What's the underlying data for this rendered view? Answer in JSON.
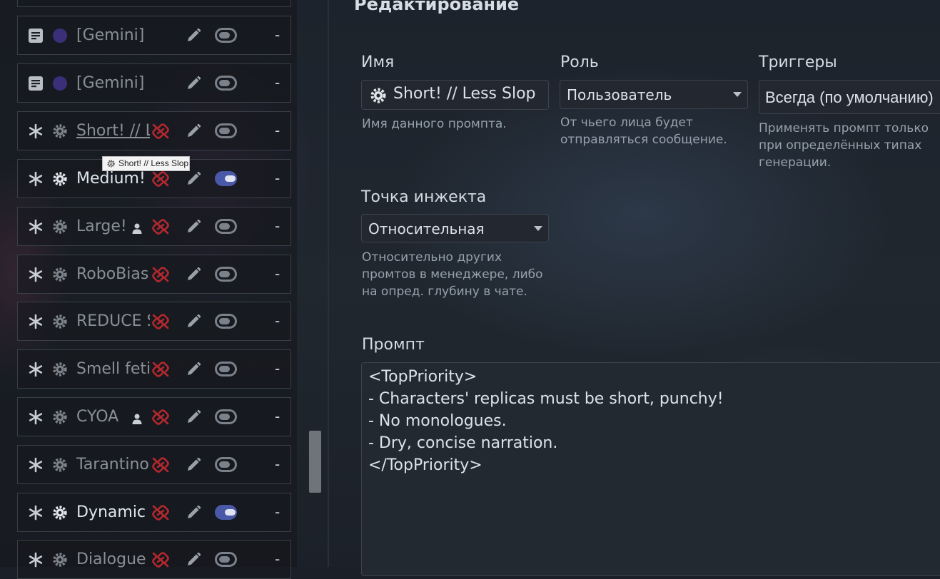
{
  "prompt_list": [
    {
      "name": "[Gemini] I",
      "type_icon": "document-icon",
      "role_icon": "circle-purple-icon",
      "enabled": false,
      "has_unlink": false,
      "has_person": false
    },
    {
      "name": "[Gemini] I",
      "type_icon": "document-icon",
      "role_icon": "circle-purple-icon",
      "enabled": false,
      "has_unlink": false,
      "has_person": false
    },
    {
      "name": "Short! // L",
      "type_icon": "asterisk-icon",
      "role_icon": "gear-icon",
      "enabled": false,
      "has_unlink": true,
      "has_person": false
    },
    {
      "name": "Medium!",
      "type_icon": "asterisk-icon",
      "role_icon": "gear-icon",
      "enabled": true,
      "has_unlink": true,
      "has_person": false
    },
    {
      "name": "Large!",
      "type_icon": "asterisk-icon",
      "role_icon": "gear-icon",
      "enabled": false,
      "has_unlink": true,
      "has_person": true
    },
    {
      "name": "RoboBias",
      "type_icon": "asterisk-icon",
      "role_icon": "gear-icon",
      "enabled": false,
      "has_unlink": true,
      "has_person": false
    },
    {
      "name": "REDUCE S",
      "type_icon": "asterisk-icon",
      "role_icon": "gear-icon",
      "enabled": false,
      "has_unlink": true,
      "has_person": false
    },
    {
      "name": "Smell feti",
      "type_icon": "asterisk-icon",
      "role_icon": "gear-icon",
      "enabled": false,
      "has_unlink": true,
      "has_person": false
    },
    {
      "name": "CYOA",
      "type_icon": "asterisk-icon",
      "role_icon": "gear-icon",
      "enabled": false,
      "has_unlink": true,
      "has_person": true
    },
    {
      "name": "Tarantino",
      "type_icon": "asterisk-icon",
      "role_icon": "gear-icon",
      "enabled": false,
      "has_unlink": true,
      "has_person": false
    },
    {
      "name": "Dynamic",
      "type_icon": "asterisk-icon",
      "role_icon": "gear-icon",
      "enabled": true,
      "has_unlink": true,
      "has_person": false
    },
    {
      "name": "Dialogue",
      "type_icon": "asterisk-icon",
      "role_icon": "gear-icon",
      "enabled": false,
      "has_unlink": true,
      "has_person": false
    }
  ],
  "row_minus_label": "-",
  "tooltip": "Short! // Less Slop",
  "editor": {
    "title": "Редактирование",
    "name_label": "Имя",
    "name_value": "Short! // Less Slop",
    "name_hint": "Имя данного промпта.",
    "role_label": "Роль",
    "role_value": "Пользователь",
    "role_hint_1": "От чьего лица будет",
    "role_hint_2": "отправляться сообщение.",
    "triggers_label": "Триггеры",
    "triggers_value": "Всегда (по умолчанию)",
    "triggers_hint_1": "Применять промпт только",
    "triggers_hint_2": "при определённых типах",
    "triggers_hint_3": "генерации.",
    "injection_label": "Точка инжекта",
    "injection_value": "Относительная",
    "injection_hint_1": "Относительно других",
    "injection_hint_2": "промтов в менеджере, либо",
    "injection_hint_3": "на опред. глубину в чате.",
    "prompt_label": "Промпт",
    "prompt_text": "<TopPriority>\n- Characters' replicas must be short, punchy!\n- No monologues.\n- Dry, concise narration.\n</TopPriority>"
  },
  "colors": {
    "accent_toggle": "#4a58a8",
    "unlink_red": "#b3282e",
    "role_purple": "#3b2f7a"
  }
}
